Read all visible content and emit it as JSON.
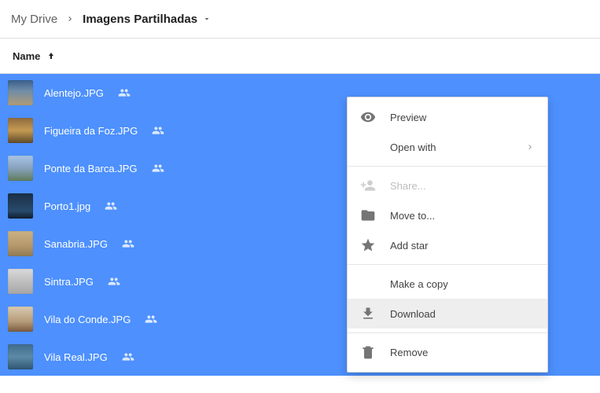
{
  "breadcrumb": {
    "root": "My Drive",
    "current": "Imagens Partilhadas"
  },
  "columns": {
    "name_label": "Name"
  },
  "files": [
    {
      "name": "Alentejo.JPG"
    },
    {
      "name": "Figueira da Foz.JPG"
    },
    {
      "name": "Ponte da Barca.JPG"
    },
    {
      "name": "Porto1.jpg"
    },
    {
      "name": "Sanabria.JPG"
    },
    {
      "name": "Sintra.JPG"
    },
    {
      "name": "Vila do Conde.JPG"
    },
    {
      "name": "Vila Real.JPG"
    }
  ],
  "thumb_gradients": [
    "linear-gradient(180deg,#3a5f8a 0%, #6d8ba8 40%, #b09c77 100%)",
    "linear-gradient(180deg,#8e6b3e 0%, #c49a52 50%, #5e4a2b 100%)",
    "linear-gradient(180deg,#a6c4e5 0%, #88a2bd 50%, #5f7c5a 100%)",
    "linear-gradient(180deg,#1b2f46 0%, #274a6c 70%, #0f1d2b 100%)",
    "linear-gradient(180deg,#c9b184 0%, #b4976a 60%, #8f7a55 100%)",
    "linear-gradient(180deg,#d9d9d9 0%, #bfbfbf 50%, #a6a6a6 100%)",
    "linear-gradient(180deg,#d8c9b0 0%, #b59b79 60%, #7a5a3e 100%)",
    "linear-gradient(180deg,#3f6b8c 0%, #5c8aa6 50%, #2e5670 100%)"
  ],
  "context_menu": {
    "preview": "Preview",
    "open_with": "Open with",
    "share": "Share...",
    "move_to": "Move to...",
    "add_star": "Add star",
    "make_copy": "Make a copy",
    "download": "Download",
    "remove": "Remove"
  }
}
